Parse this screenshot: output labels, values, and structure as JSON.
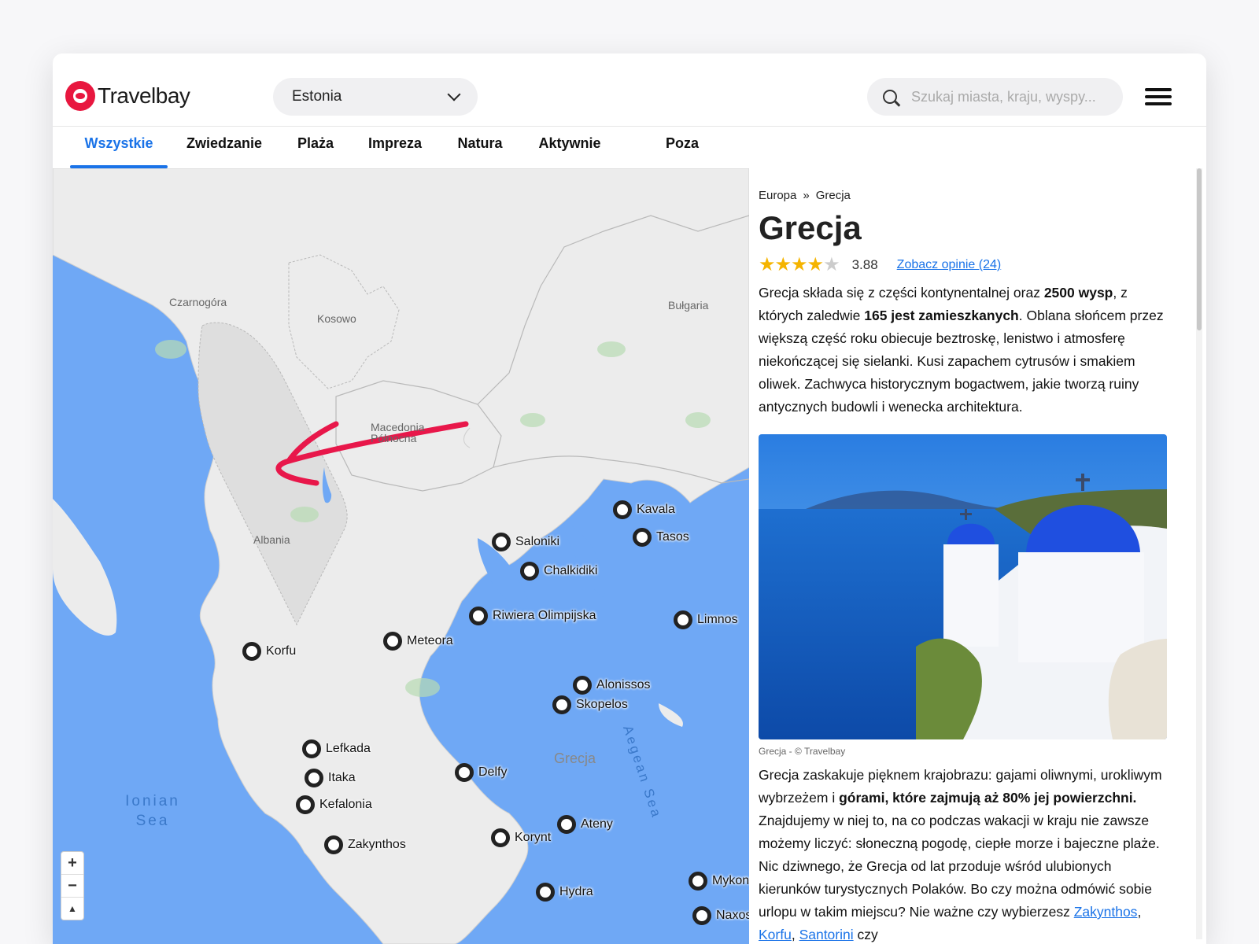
{
  "header": {
    "logo_text": "Travelbay",
    "country_select": "Estonia",
    "search_placeholder": "Szukaj miasta, kraju, wyspy..."
  },
  "tabs": [
    {
      "label": "Wszystkie",
      "active": true
    },
    {
      "label": "Zwiedzanie"
    },
    {
      "label": "Plaża"
    },
    {
      "label": "Impreza"
    },
    {
      "label": "Natura"
    },
    {
      "label": "Aktywnie"
    },
    {
      "label": "Poza szlakiem"
    }
  ],
  "map": {
    "country_labels": [
      "Czarnogóra",
      "Kosowo",
      "Bułgaria",
      "Macedonia Północna",
      "Albania",
      "Grecja"
    ],
    "sea_labels": [
      "Ionian Sea",
      "Aegean Sea"
    ],
    "places": [
      "Kavala",
      "Tasos",
      "Saloniki",
      "Chalkidiki",
      "Riwiera Olimpijska",
      "Limnos",
      "Meteora",
      "Korfu",
      "Alonissos",
      "Skopelos",
      "Lefkada",
      "Delfy",
      "Itaka",
      "Kefalonia",
      "Ateny",
      "Korynt",
      "Zakynthos",
      "Hydra",
      "Mykonos",
      "Naxos"
    ],
    "zoom": {
      "in": "+",
      "out": "−",
      "compass": "▲"
    }
  },
  "panel": {
    "breadcrumb": [
      "Europa",
      "Grecja"
    ],
    "breadcrumb_sep": "»",
    "title": "Grecja",
    "rating": 3.88,
    "rating_label": "3.88",
    "stars_filled": "★★★★",
    "stars_empty": "★",
    "reviews_link": "Zobacz opinie (24)",
    "intro": {
      "t1": "Grecja składa się z części kontynentalnej oraz ",
      "b1": "2500 wysp",
      "t2": ", z których zaledwie ",
      "b2": "165 jest zamieszkanych",
      "t3": ". Oblana słońcem przez większą część roku obiecuje beztroskę, lenistwo i atmosferę niekończącej się sielanki. Kusi zapachem cytrusów i smakiem oliwek. Zachwyca historycznym bogactwem, jakie tworzą ruiny antycznych budowli i wenecka architektura."
    },
    "photo_caption": "Grecja - © Travelbay",
    "second": {
      "t1": "Grecja zaskakuje pięknem krajobrazu: gajami oliwnymi, urokliwym wybrzeżem i ",
      "b1": "górami, które zajmują aż 80% jej powierzchni.",
      "t2": " Znajdujemy w niej to, na co podczas wakacji w kraju nie zawsze możemy liczyć: słoneczną pogodę, ciepłe morze i bajeczne plaże. Nic dziwnego, że Grecja od lat przoduje wśród ulubionych kierunków turystycznych Polaków. Bo czy można odmówić sobie urlopu w takim miejscu? Nie ważne czy wybierzesz ",
      "l1": "Zakynthos",
      "c1": ", ",
      "l2": "Korfu",
      "c2": ", ",
      "l3": "Santorini",
      "t3": " czy"
    }
  },
  "colors": {
    "accent": "#1a73e8",
    "brand": "#e8173f",
    "sea": "#6fa8f5",
    "land": "#ececec",
    "arrow": "#e8174a"
  }
}
